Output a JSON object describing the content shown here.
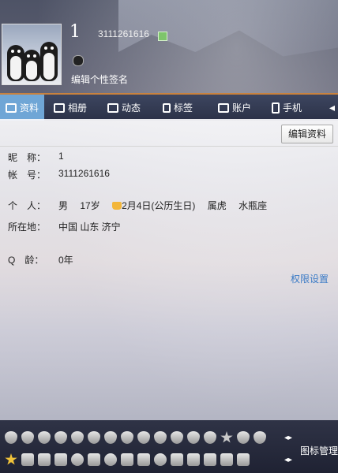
{
  "header": {
    "nickname": "1",
    "qq_number": "3111261616",
    "signature_placeholder": "编辑个性签名"
  },
  "tabs": [
    {
      "label": "资料",
      "icon": "profile-card-icon",
      "active": true
    },
    {
      "label": "相册",
      "icon": "photo-album-icon"
    },
    {
      "label": "动态",
      "icon": "feed-list-icon"
    },
    {
      "label": "标签",
      "icon": "bookmark-tag-icon"
    },
    {
      "label": "账户",
      "icon": "wallet-icon"
    },
    {
      "label": "手机",
      "icon": "phone-icon"
    }
  ],
  "toolbar": {
    "edit_label": "编辑资料"
  },
  "profile": {
    "nickname_label": "昵　称：",
    "nickname_value": "1",
    "account_label": "帐　号：",
    "account_value": "3111261616",
    "personal_label": "个　人：",
    "gender": "男",
    "age": "17岁",
    "birthday": "2月4日(公历生日)",
    "zodiac": "属虎",
    "constellation": "水瓶座",
    "location_label": "所在地：",
    "location_value": "中国 山东 济宁",
    "qage_label": "Q　龄：",
    "qage_value": "0年"
  },
  "perm_label": "权限设置",
  "icon_bar": {
    "manage_label": "图标管理"
  },
  "colors": {
    "accent": "#6fa6d6",
    "tab_top": "#c9823e",
    "link": "#3b7bc6"
  }
}
